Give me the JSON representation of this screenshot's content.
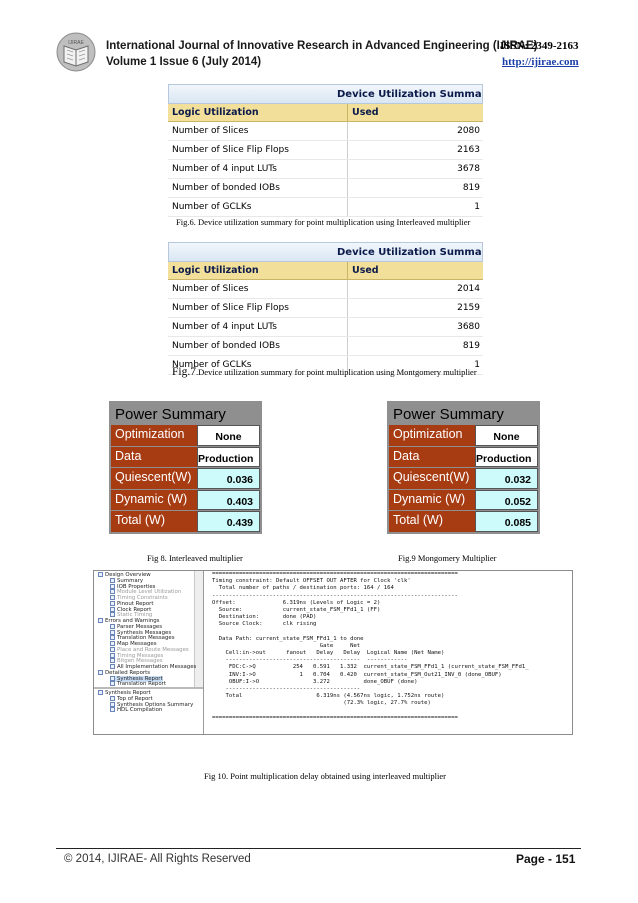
{
  "header": {
    "journal": "International Journal of Innovative Research in Advanced Engineering (IJIRAE)",
    "issn": "ISSN: 2349-2163",
    "volume": "Volume 1 Issue 6 (July 2014)",
    "url": "http://ijirae.com",
    "logo_text": "IJIRAE"
  },
  "fig6": {
    "table_title": "Device Utilization Summary (est",
    "col_logic": "Logic Utilization",
    "col_used": "Used",
    "rows": [
      {
        "label": "Number of Slices",
        "value": "2080"
      },
      {
        "label": "Number of Slice Flip Flops",
        "value": "2163"
      },
      {
        "label": "Number of 4 input LUTs",
        "value": "3678"
      },
      {
        "label": "Number of bonded IOBs",
        "value": "819"
      },
      {
        "label": "Number of GCLKs",
        "value": "1"
      }
    ],
    "caption": "Fig.6. Device utilization summary for point multiplication using Interleaved multiplier"
  },
  "fig7": {
    "table_title": "Device Utilization Summary (est",
    "col_logic": "Logic Utilization",
    "col_used": "Used",
    "rows": [
      {
        "label": "Number of Slices",
        "value": "2014"
      },
      {
        "label": "Number of Slice Flip Flops",
        "value": "2159"
      },
      {
        "label": "Number of 4 input LUTs",
        "value": "3680"
      },
      {
        "label": "Number of bonded IOBs",
        "value": "819"
      },
      {
        "label": "Number of GCLKs",
        "value": "1"
      }
    ],
    "caption_prefix": "Fig.7",
    "caption_rest": ".Device utilization summary for point multiplication using Montgomery multiplier"
  },
  "power_left": {
    "title": "Power Summary",
    "rows": [
      {
        "label": "Optimization",
        "value": "None"
      },
      {
        "label": "Data",
        "value": "Production"
      },
      {
        "label": "Quiescent(W)",
        "value": "0.036"
      },
      {
        "label": "Dynamic (W)",
        "value": "0.403"
      },
      {
        "label": "Total (W)",
        "value": "0.439"
      }
    ],
    "caption": "Fig 8.  Interleaved multiplier"
  },
  "power_right": {
    "title": "Power Summary",
    "rows": [
      {
        "label": "Optimization",
        "value": "None"
      },
      {
        "label": "Data",
        "value": "Production"
      },
      {
        "label": "Quiescent(W)",
        "value": "0.032"
      },
      {
        "label": "Dynamic (W)",
        "value": "0.052"
      },
      {
        "label": "Total (W)",
        "value": "0.085"
      }
    ],
    "caption": "Fig.9 Mongomery Multiplier"
  },
  "report": {
    "tree": [
      {
        "text": "Design Overview",
        "level": 0
      },
      {
        "text": "Summary",
        "level": 1
      },
      {
        "text": "IOB Properties",
        "level": 1
      },
      {
        "text": "Module Level Utilization",
        "level": 1,
        "dim": true
      },
      {
        "text": "Timing Constraints",
        "level": 1,
        "dim": true
      },
      {
        "text": "Pinout Report",
        "level": 1
      },
      {
        "text": "Clock Report",
        "level": 1
      },
      {
        "text": "Static Timing",
        "level": 1,
        "dim": true
      },
      {
        "text": "Errors and Warnings",
        "level": 0
      },
      {
        "text": "Parser Messages",
        "level": 1
      },
      {
        "text": "Synthesis Messages",
        "level": 1
      },
      {
        "text": "Translation Messages",
        "level": 1
      },
      {
        "text": "Map Messages",
        "level": 1
      },
      {
        "text": "Place and Route Messages",
        "level": 1,
        "dim": true
      },
      {
        "text": "Timing Messages",
        "level": 1,
        "dim": true
      },
      {
        "text": "Bitgen Messages",
        "level": 1,
        "dim": true
      },
      {
        "text": "All Implementation Messages",
        "level": 1
      },
      {
        "text": "Detailed Reports",
        "level": 0
      },
      {
        "text": "Synthesis Report",
        "level": 1,
        "selected": true
      },
      {
        "text": "Translation Report",
        "level": 1
      }
    ],
    "tree_bottom": [
      {
        "text": "Synthesis Report",
        "level": 0
      },
      {
        "text": "Top of Report",
        "level": 1
      },
      {
        "text": "Synthesis Options Summary",
        "level": 1
      },
      {
        "text": "HDL Compilation",
        "level": 1
      }
    ],
    "lines": [
      "=========================================================================",
      "Timing constraint: Default OFFSET OUT AFTER for Clock 'clk'",
      "  Total number of paths / destination ports: 164 / 164",
      "-------------------------------------------------------------------------",
      "Offset:              6.319ns (Levels of Logic = 2)",
      "  Source:            current_state_FSM_FFd1_1 (FF)",
      "  Destination:       done (PAD)",
      "  Source Clock:      clk rising",
      "",
      "  Data Path: current_state_FSM_FFd1_1 to done",
      "                                Gate     Net",
      "    Cell:in->out      fanout   Delay   Delay  Logical Name (Net Name)",
      "    ----------------------------------------  ------------",
      "     FDC:C->Q           254   0.591   1.332  current_state_FSM_FFd1_1 (current_state_FSM_FFd1_",
      "     INV:I->O             1   0.704   0.420  current_state_FSM_Out21_INV_0 (done_OBUF)",
      "     OBUF:I->O                3.272          done_OBUF (done)",
      "    ----------------------------------------",
      "    Total                      6.319ns (4.567ns logic, 1.752ns route)",
      "                                       (72.3% logic, 27.7% route)",
      "",
      "========================================================================="
    ],
    "caption": "Fig 10. Point multiplication delay obtained using interleaved multiplier"
  },
  "footer": {
    "copyright": "© 2014, IJIRAE- All Rights Reserved",
    "page": "Page - 151"
  }
}
